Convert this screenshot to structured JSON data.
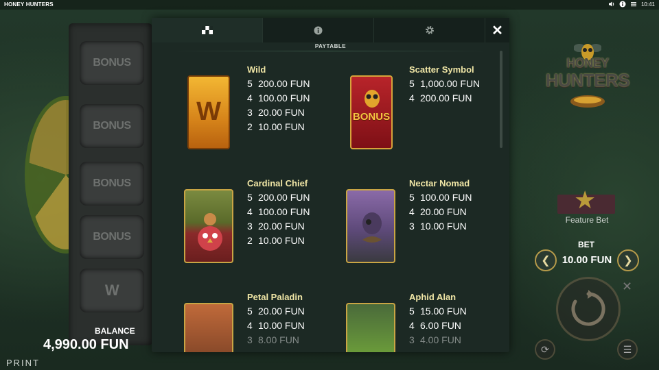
{
  "app": {
    "title": "HONEY HUNTERS",
    "clock": "10:41"
  },
  "left": {
    "reels": [
      "BONUS",
      "BONUS",
      "BONUS",
      "BONUS",
      "W"
    ]
  },
  "balance": {
    "label": "BALANCE",
    "value": "4,990.00 FUN"
  },
  "print": {
    "label": "PRINT"
  },
  "right": {
    "logo": [
      "HONEY",
      "HUNTERS"
    ],
    "feature_bet": "Feature Bet",
    "bet_label": "BET",
    "bet_value": "10.00 FUN"
  },
  "paytable": {
    "section_label": "PAYTABLE",
    "tabs": [
      "paytable-icon",
      "info-icon",
      "settings-icon"
    ],
    "entries": [
      {
        "name": "Wild",
        "symbol": "W",
        "pays": [
          [
            "5",
            "200.00 FUN"
          ],
          [
            "4",
            "100.00 FUN"
          ],
          [
            "3",
            "20.00 FUN"
          ],
          [
            "2",
            "10.00 FUN"
          ]
        ]
      },
      {
        "name": "Scatter Symbol",
        "symbol": "BONUS",
        "pays": [
          [
            "5",
            "1,000.00 FUN"
          ],
          [
            "4",
            "200.00 FUN"
          ]
        ]
      },
      {
        "name": "Cardinal Chief",
        "pays": [
          [
            "5",
            "200.00 FUN"
          ],
          [
            "4",
            "100.00 FUN"
          ],
          [
            "3",
            "20.00 FUN"
          ],
          [
            "2",
            "10.00 FUN"
          ]
        ]
      },
      {
        "name": "Nectar Nomad",
        "pays": [
          [
            "5",
            "100.00 FUN"
          ],
          [
            "4",
            "20.00 FUN"
          ],
          [
            "3",
            "10.00 FUN"
          ]
        ]
      },
      {
        "name": "Petal Paladin",
        "pays": [
          [
            "5",
            "20.00 FUN"
          ],
          [
            "4",
            "10.00 FUN"
          ],
          [
            "3",
            "8.00 FUN"
          ]
        ]
      },
      {
        "name": "Aphid Alan",
        "pays": [
          [
            "5",
            "15.00 FUN"
          ],
          [
            "4",
            "6.00 FUN"
          ],
          [
            "3",
            "4.00 FUN"
          ]
        ]
      }
    ]
  }
}
